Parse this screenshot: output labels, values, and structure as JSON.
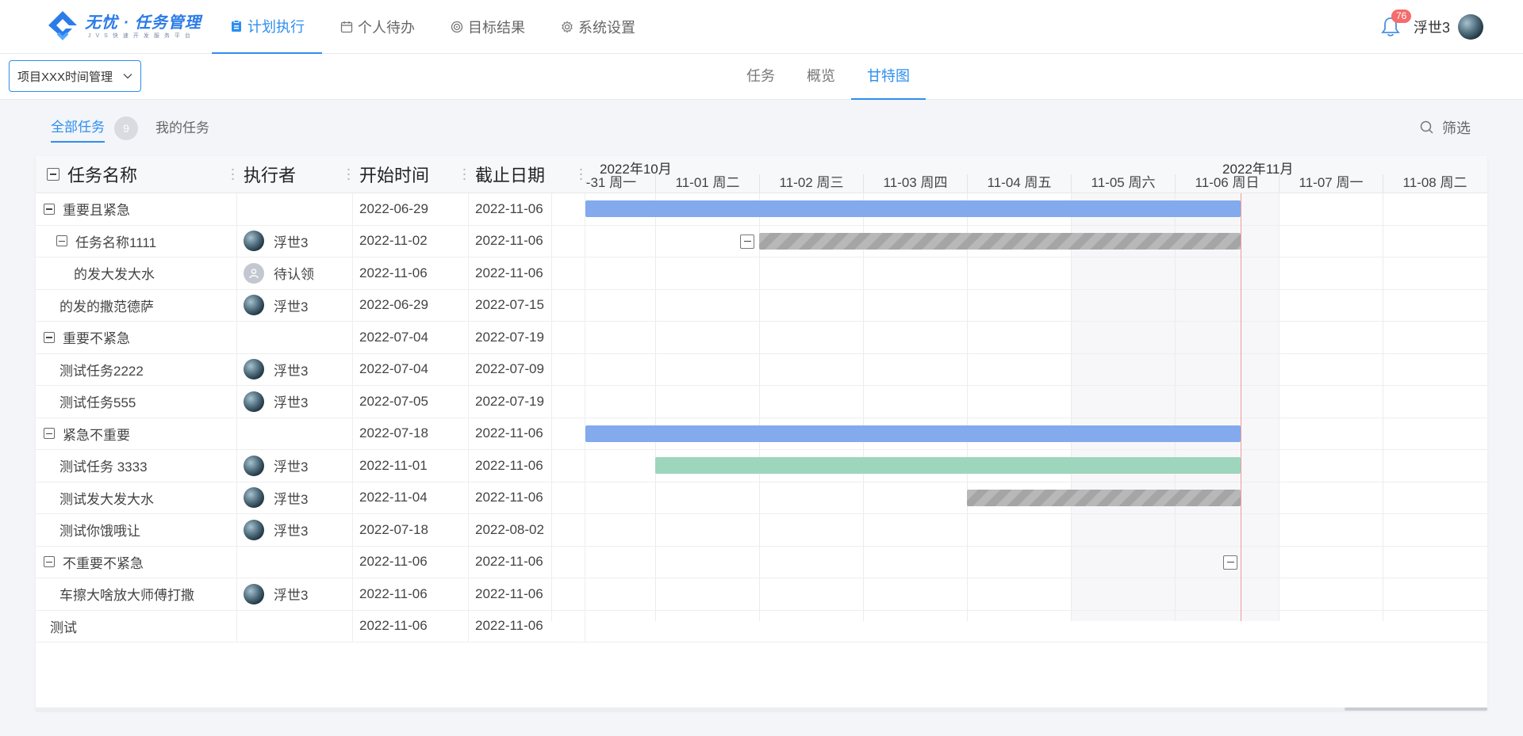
{
  "app": {
    "logo_title": "无忧 · 任务管理",
    "logo_subtitle": "JVS快速开发服务平台"
  },
  "nav": {
    "items": [
      {
        "label": "计划执行",
        "icon": "clipboard-icon",
        "active": true
      },
      {
        "label": "个人待办",
        "icon": "calendar-icon",
        "active": false
      },
      {
        "label": "目标结果",
        "icon": "target-icon",
        "active": false
      },
      {
        "label": "系统设置",
        "icon": "gear-icon",
        "active": false
      }
    ]
  },
  "user": {
    "notification_count": "76",
    "name": "浮世3"
  },
  "project": {
    "selected": "项目XXX时间管理"
  },
  "view_tabs": [
    {
      "label": "任务",
      "active": false
    },
    {
      "label": "概览",
      "active": false
    },
    {
      "label": "甘特图",
      "active": true
    }
  ],
  "filters": {
    "all_label": "全部任务",
    "all_count": "9",
    "mine_label": "我的任务",
    "filter_label": "筛选"
  },
  "grid": {
    "headers": [
      "任务名称",
      "执行者",
      "开始时间",
      "截止日期"
    ],
    "rows": [
      {
        "name": "重要且紧急",
        "level": 0,
        "group": true,
        "assignee": "",
        "avatar": "none",
        "start": "2022-06-29",
        "end": "2022-11-06"
      },
      {
        "name": "任务名称1111",
        "level": 1,
        "group": true,
        "assignee": "浮世3",
        "avatar": "photo",
        "start": "2022-11-02",
        "end": "2022-11-06"
      },
      {
        "name": "的发大发大水",
        "level": 2,
        "group": false,
        "assignee": "待认领",
        "avatar": "pending",
        "start": "2022-11-06",
        "end": "2022-11-06"
      },
      {
        "name": "的发的撒范德萨",
        "level": 1,
        "group": false,
        "assignee": "浮世3",
        "avatar": "photo",
        "start": "2022-06-29",
        "end": "2022-07-15"
      },
      {
        "name": "重要不紧急",
        "level": 0,
        "group": true,
        "assignee": "",
        "avatar": "none",
        "start": "2022-07-04",
        "end": "2022-07-19"
      },
      {
        "name": "测试任务2222",
        "level": 1,
        "group": false,
        "assignee": "浮世3",
        "avatar": "photo",
        "start": "2022-07-04",
        "end": "2022-07-09"
      },
      {
        "name": "测试任务555",
        "level": 1,
        "group": false,
        "assignee": "浮世3",
        "avatar": "photo",
        "start": "2022-07-05",
        "end": "2022-07-19"
      },
      {
        "name": "紧急不重要",
        "level": 0,
        "group": true,
        "assignee": "",
        "avatar": "none",
        "start": "2022-07-18",
        "end": "2022-11-06"
      },
      {
        "name": "测试任务 3333",
        "level": 1,
        "group": false,
        "assignee": "浮世3",
        "avatar": "photo",
        "start": "2022-11-01",
        "end": "2022-11-06"
      },
      {
        "name": "测试发大发大水",
        "level": 1,
        "group": false,
        "assignee": "浮世3",
        "avatar": "photo",
        "start": "2022-11-04",
        "end": "2022-11-06"
      },
      {
        "name": "测试你饿哦让",
        "level": 1,
        "group": false,
        "assignee": "浮世3",
        "avatar": "photo",
        "start": "2022-07-18",
        "end": "2022-08-02"
      },
      {
        "name": "不重要不紧急",
        "level": 0,
        "group": true,
        "assignee": "",
        "avatar": "none",
        "start": "2022-11-06",
        "end": "2022-11-06"
      },
      {
        "name": "车擦大啥放大师傅打撒",
        "level": 1,
        "group": false,
        "assignee": "浮世3",
        "avatar": "photo",
        "start": "2022-11-06",
        "end": "2022-11-06"
      },
      {
        "name": "测试",
        "level": 0,
        "group": false,
        "assignee": "",
        "avatar": "none",
        "start": "2022-11-06",
        "end": "2022-11-06"
      }
    ]
  },
  "gantt": {
    "months": [
      "2022年10月",
      "2022年11月"
    ],
    "days": [
      "10-31 周一",
      "11-01 周二",
      "11-02 周三",
      "11-03 周四",
      "11-04 周五",
      "11-05 周六",
      "11-06 周日",
      "11-07 周一",
      "11-08 周二"
    ],
    "weekend_days": [
      "11-05 周六",
      "11-06 周日"
    ],
    "today": "11-06 周日",
    "bars": [
      {
        "row": 0,
        "style": "blue",
        "from": "10-31 周一",
        "to": "11-06 周日"
      },
      {
        "row": 1,
        "style": "gray",
        "from": "11-02 周三",
        "to": "11-06 周日",
        "collapse_toggle": true
      },
      {
        "row": 7,
        "style": "blue",
        "from": "10-31 周一",
        "to": "11-06 周日"
      },
      {
        "row": 8,
        "style": "green",
        "from": "11-01 周二",
        "to": "11-06 周日"
      },
      {
        "row": 9,
        "style": "gray",
        "from": "11-04 周五",
        "to": "11-06 周日"
      }
    ],
    "milestone_toggles": [
      {
        "row": 11,
        "day": "11-06 周日"
      }
    ],
    "colors": {
      "blue": "#82aaed",
      "green": "#9dd6bd",
      "gray": "#b0b0b0",
      "today_line": "#f29a9a",
      "accent": "#2e8ef0"
    }
  }
}
